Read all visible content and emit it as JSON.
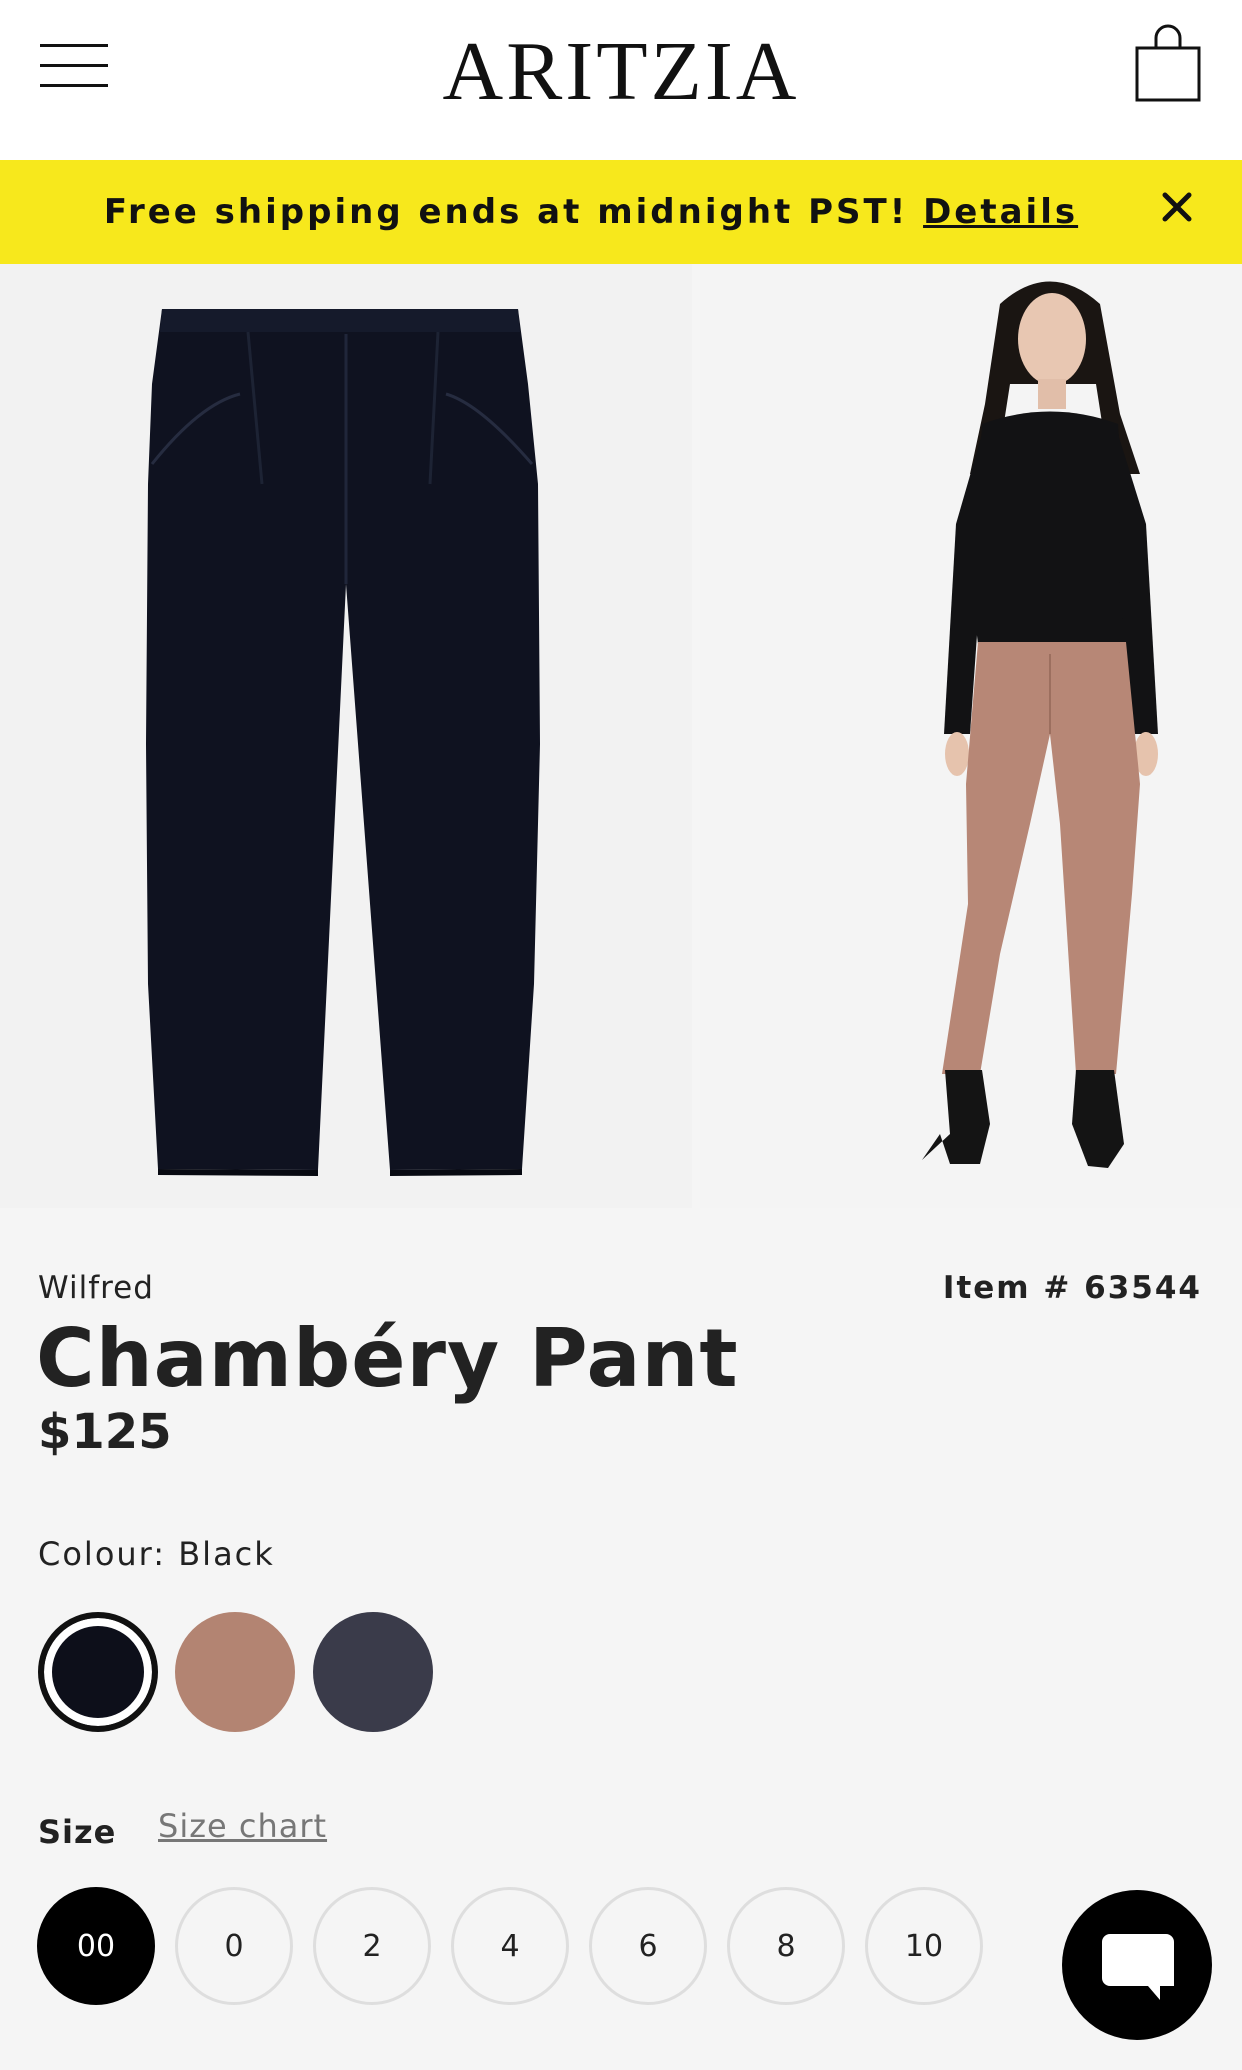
{
  "header": {
    "logo": "ARITZIA",
    "menu_icon": "hamburger-menu-icon",
    "bag_icon": "shopping-bag-icon"
  },
  "promo": {
    "text": "Free shipping ends at midnight PST!",
    "link": "Details",
    "close_icon": "close-icon",
    "background": "#f7e81c"
  },
  "gallery": {
    "images": [
      "black-pant-flatlay",
      "model-wearing-brown-pant"
    ]
  },
  "product": {
    "brand": "Wilfred",
    "item_number": "Item # 63544",
    "name": "Chambéry Pant",
    "price": "$125"
  },
  "colour": {
    "label": "Colour: Black",
    "swatches": [
      {
        "name": "Black",
        "hex": "#0d0f1a",
        "selected": true
      },
      {
        "name": "Brown",
        "hex": "#b38472",
        "selected": false
      },
      {
        "name": "Navy",
        "hex": "#3a3b4a",
        "selected": false
      }
    ]
  },
  "size": {
    "label": "Size",
    "chart_link": "Size chart",
    "options": [
      "00",
      "0",
      "2",
      "4",
      "6",
      "8",
      "10"
    ],
    "selected": "00"
  },
  "chat": {
    "icon": "chat-bubble-icon"
  }
}
